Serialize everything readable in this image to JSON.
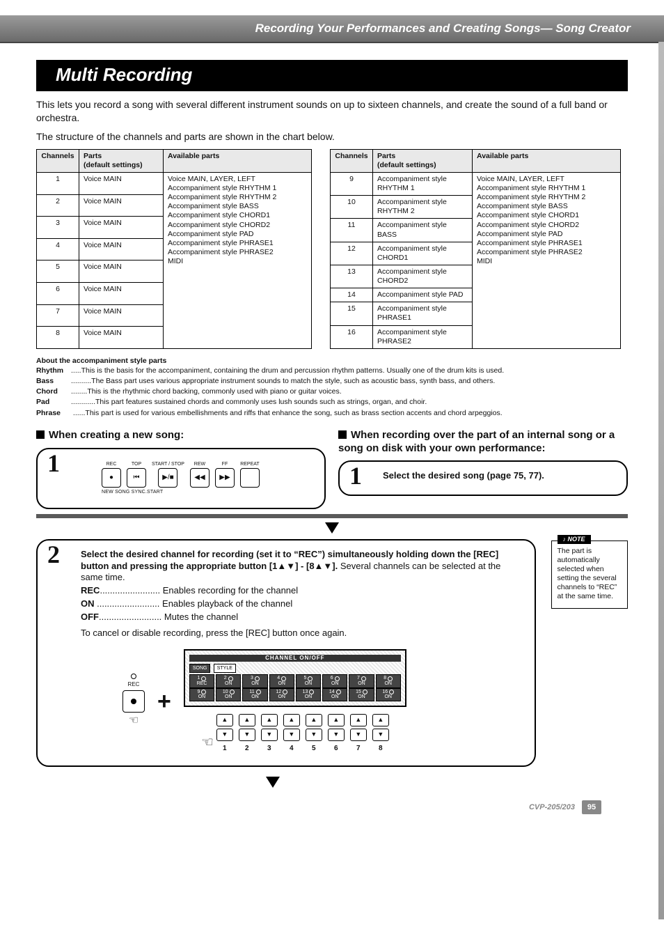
{
  "breadcrumb": "Recording Your Performances and Creating Songs— Song Creator",
  "section_title": "Multi Recording",
  "intro1": "This lets you record a song with several different instrument sounds on up to sixteen channels, and create the sound of a full band or orchestra.",
  "intro2": "The structure of the channels and parts are shown in the chart below.",
  "table_headers": {
    "channels": "Channels",
    "parts": "Parts\n(default settings)",
    "available": "Available parts"
  },
  "left_table": {
    "rows": [
      {
        "ch": "1",
        "parts": "Voice MAIN"
      },
      {
        "ch": "2",
        "parts": "Voice MAIN"
      },
      {
        "ch": "3",
        "parts": "Voice MAIN"
      },
      {
        "ch": "4",
        "parts": "Voice MAIN"
      },
      {
        "ch": "5",
        "parts": "Voice MAIN"
      },
      {
        "ch": "6",
        "parts": "Voice MAIN"
      },
      {
        "ch": "7",
        "parts": "Voice MAIN"
      },
      {
        "ch": "8",
        "parts": "Voice MAIN"
      }
    ],
    "available": "Voice MAIN, LAYER, LEFT\nAccompaniment style RHYTHM 1\nAccompaniment style RHYTHM 2\nAccompaniment style BASS\nAccompaniment style CHORD1\nAccompaniment style CHORD2\nAccompaniment style PAD\nAccompaniment style PHRASE1\nAccompaniment style PHRASE2\nMIDI"
  },
  "right_table": {
    "rows": [
      {
        "ch": "9",
        "parts": "Accompaniment style RHYTHM 1"
      },
      {
        "ch": "10",
        "parts": "Accompaniment style RHYTHM 2"
      },
      {
        "ch": "11",
        "parts": "Accompaniment style BASS"
      },
      {
        "ch": "12",
        "parts": "Accompaniment style CHORD1"
      },
      {
        "ch": "13",
        "parts": "Accompaniment style CHORD2"
      },
      {
        "ch": "14",
        "parts": "Accompaniment style PAD"
      },
      {
        "ch": "15",
        "parts": "Accompaniment style PHRASE1"
      },
      {
        "ch": "16",
        "parts": "Accompaniment style PHRASE2"
      }
    ],
    "available": "Voice MAIN, LAYER, LEFT\nAccompaniment style RHYTHM 1\nAccompaniment style RHYTHM 2\nAccompaniment style BASS\nAccompaniment style CHORD1\nAccompaniment style CHORD2\nAccompaniment style PAD\nAccompaniment style PHRASE1\nAccompaniment style PHRASE2\nMIDI"
  },
  "about": {
    "heading": "About the accompaniment style parts",
    "rhythm": {
      "label": "Rhythm",
      "text": ".....This is the basis for the accompaniment, containing the drum and percussion rhythm patterns. Usually one of the drum kits is used."
    },
    "bass": {
      "label": "Bass",
      "text": "..........The Bass part uses various appropriate instrument sounds to match the style, such as acoustic bass, synth bass, and others."
    },
    "chord": {
      "label": "Chord",
      "text": "........This is the rhythmic chord backing, commonly used with piano or guitar voices."
    },
    "pad": {
      "label": "Pad",
      "text": "............This part features sustained chords and commonly uses lush sounds such as strings, organ, and choir."
    },
    "phrase": {
      "label": "Phrase",
      "text": " ......This part is used for various embellishments and riffs that enhance the song, such as brass section accents and chord arpeggios."
    }
  },
  "left_head": "When creating a new song:",
  "right_head": "When recording over the part of an internal song or a song on disk with your own performance:",
  "step1_num": "1",
  "transport": {
    "labels": [
      "REC",
      "TOP",
      "START / STOP",
      "REW",
      "FF",
      "REPEAT"
    ],
    "glyphs": [
      "●",
      "⏮",
      "▶/■",
      "◀◀",
      "▶▶",
      ""
    ],
    "sync": "NEW SONG      SYNC.START"
  },
  "step1r_text": "Select the desired song (page 75, 77).",
  "step2_num": "2",
  "step2": {
    "line1": "Select the desired channel for recording (set it to “REC”) simultaneously holding down the [REC] button and pressing the appropriate button [1▲▼] - [8▲▼].",
    "line1b": " Several channels can be selected at the same time.",
    "rec_lbl": "REC",
    "rec_txt": "........................ Enables recording for the channel",
    "on_lbl": "ON",
    "on_txt": " ......................... Enables playback of the channel",
    "off_lbl": "OFF",
    "off_txt": "......................... Mutes the channel",
    "cancel": "To cancel or disable recording, press the [REC] button once again."
  },
  "panel": {
    "title": "CHANNEL ON/OFF",
    "side1": "SONG",
    "side2": "STYLE",
    "row1": [
      {
        "n": "1",
        "s": "REC"
      },
      {
        "n": "2",
        "s": "ON"
      },
      {
        "n": "3",
        "s": "ON"
      },
      {
        "n": "4",
        "s": "ON"
      },
      {
        "n": "5",
        "s": "ON"
      },
      {
        "n": "6",
        "s": "ON"
      },
      {
        "n": "7",
        "s": "ON"
      },
      {
        "n": "8",
        "s": "ON"
      }
    ],
    "row2": [
      {
        "n": "9",
        "s": "ON"
      },
      {
        "n": "10",
        "s": "ON"
      },
      {
        "n": "11",
        "s": "ON"
      },
      {
        "n": "12",
        "s": "ON"
      },
      {
        "n": "13",
        "s": "ON"
      },
      {
        "n": "14",
        "s": "ON"
      },
      {
        "n": "15",
        "s": "ON"
      },
      {
        "n": "16",
        "s": "ON"
      }
    ],
    "numbers": [
      "1",
      "2",
      "3",
      "4",
      "5",
      "6",
      "7",
      "8"
    ]
  },
  "rec_label": "REC",
  "note": {
    "tag": "NOTE",
    "text": "The part is automatically selected when setting the several channels to “REC” at the same time."
  },
  "footer": {
    "model": "CVP-205/203",
    "page": "95"
  }
}
